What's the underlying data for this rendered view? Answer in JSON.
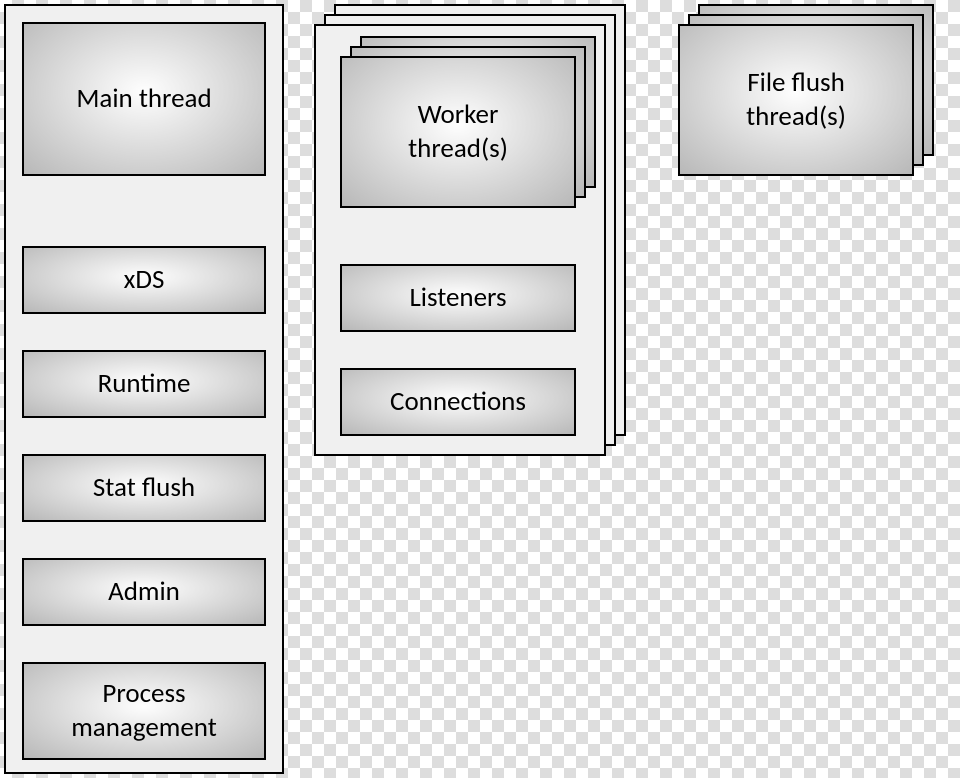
{
  "main": {
    "title": "Main thread",
    "items": [
      "xDS",
      "Runtime",
      "Stat flush",
      "Admin",
      "Process\nmanagement"
    ]
  },
  "worker": {
    "title": "Worker\nthread(s)",
    "items": [
      "Listeners",
      "Connections"
    ]
  },
  "file_flush": {
    "title": "File flush\nthread(s)"
  }
}
